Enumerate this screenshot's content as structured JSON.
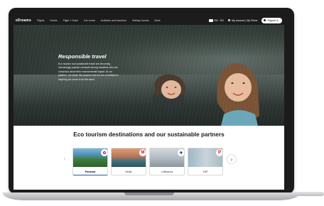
{
  "nav": {
    "logo": "eDreams",
    "items": [
      "Flights",
      "Hotels",
      "Flight + Hotel",
      "Car rental",
      "Activities and transfers",
      "Holiday homes",
      "More"
    ],
    "currency": "EN · SG",
    "account": "My account | My Prime",
    "support": "Support a..."
  },
  "hero": {
    "title": "Responsible travel",
    "text": "Eco tourism and sustainable travel are becoming increasingly popular concepts among travellers who are conscious about their environmental impact. At our platform, we share this passion and we are committed to inspiring our users to do the same."
  },
  "partners": {
    "title": "Eco tourism destinations and our sustainable partners",
    "cards": [
      {
        "label": "Panama",
        "badge_color": "#e4007c"
      },
      {
        "label": "Melia",
        "badge_color": "#c8102e"
      },
      {
        "label": "Lufthansa",
        "badge_color": "#05164d"
      },
      {
        "label": "TAP",
        "badge_color": "#e3000f"
      }
    ]
  },
  "colors": {
    "accent": "#1561a8",
    "nav_bg": "#1c1c1c"
  }
}
